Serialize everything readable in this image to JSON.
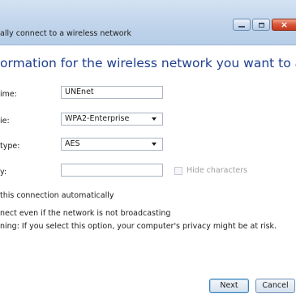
{
  "window": {
    "title": "ally connect to a wireless network",
    "controls": {
      "minimize_icon": "minimize-icon",
      "maximize_icon": "maximize-icon",
      "close_icon": "close-icon",
      "close_glyph": "×"
    }
  },
  "heading": "ormation for the wireless network you want to add",
  "form": {
    "network_name": {
      "label": "ime:",
      "value": "UNEnet"
    },
    "security_type": {
      "label": "ie:",
      "selected": "WPA2-Enterprise"
    },
    "encryption_type": {
      "label": "type:",
      "selected": "AES"
    },
    "security_key": {
      "label": "y:",
      "value": ""
    },
    "hide_characters": {
      "label": "Hide characters",
      "checked": false
    }
  },
  "options": {
    "start_automatically": "this connection automatically",
    "connect_not_broadcasting": "nect even if the network is not broadcasting",
    "warning": "ning: If you select this option, your computer's privacy might be at risk."
  },
  "buttons": {
    "next": "Next",
    "cancel": "Cancel"
  },
  "colors": {
    "heading": "#1f3f8f",
    "titlebar": "#c3d6ec",
    "close_button": "#d9553a"
  }
}
